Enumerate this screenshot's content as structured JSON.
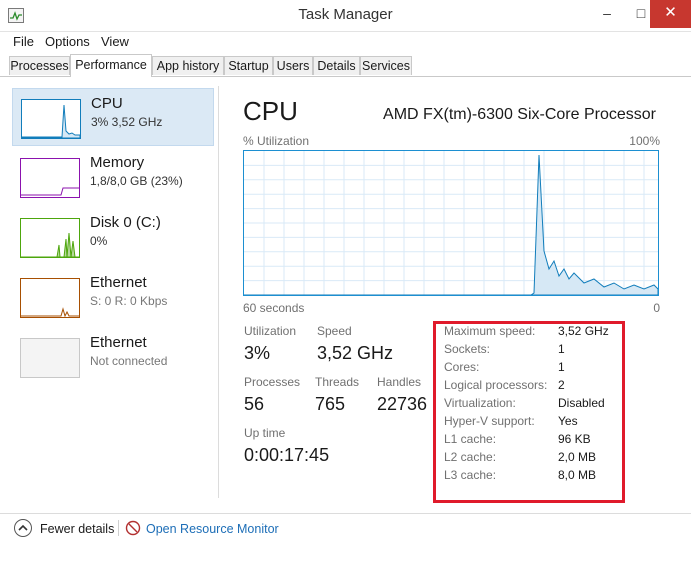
{
  "window": {
    "title": "Task Manager",
    "minimize": "–",
    "maximize": "□",
    "close": "✕"
  },
  "menu": [
    "File",
    "Options",
    "View"
  ],
  "tabs": [
    "Processes",
    "Performance",
    "App history",
    "Startup",
    "Users",
    "Details",
    "Services"
  ],
  "active_tab": "Performance",
  "sidebar": [
    {
      "name": "CPU",
      "sub": "3% 3,52 GHz",
      "color": "#117dbb"
    },
    {
      "name": "Memory",
      "sub": "1,8/8,0 GB (23%)",
      "color": "#8b12ae"
    },
    {
      "name": "Disk 0 (C:)",
      "sub": "0%",
      "color": "#4da60c"
    },
    {
      "name": "Ethernet",
      "sub": "S: 0 R: 0 Kbps",
      "color": "#a74f01"
    },
    {
      "name": "Ethernet",
      "sub": "Not connected",
      "color": "#c8c8c8"
    }
  ],
  "main": {
    "title": "CPU",
    "processor": "AMD FX(tm)-6300 Six-Core Processor",
    "graph": {
      "top_left": "% Utilization",
      "top_right": "100%",
      "bottom_left": "60 seconds",
      "bottom_right": "0"
    },
    "stats": {
      "utilization_label": "Utilization",
      "utilization": "3%",
      "speed_label": "Speed",
      "speed": "3,52 GHz",
      "processes_label": "Processes",
      "processes": "56",
      "threads_label": "Threads",
      "threads": "765",
      "handles_label": "Handles",
      "handles": "22736",
      "uptime_label": "Up time",
      "uptime": "0:00:17:45"
    },
    "details": [
      {
        "k": "Maximum speed:",
        "v": "3,52 GHz"
      },
      {
        "k": "Sockets:",
        "v": "1"
      },
      {
        "k": "Cores:",
        "v": "1"
      },
      {
        "k": "Logical processors:",
        "v": "2"
      },
      {
        "k": "Virtualization:",
        "v": "Disabled"
      },
      {
        "k": "Hyper-V support:",
        "v": "Yes"
      },
      {
        "k": "L1 cache:",
        "v": "96 KB"
      },
      {
        "k": "L2 cache:",
        "v": "2,0 MB"
      },
      {
        "k": "L3 cache:",
        "v": "8,0 MB"
      }
    ]
  },
  "footer": {
    "fewer_details": "Fewer details",
    "resource_monitor": "Open Resource Monitor"
  },
  "colors": {
    "accent": "#117dbb",
    "highlight": "#e01a2b",
    "link": "#1d6eb7"
  }
}
